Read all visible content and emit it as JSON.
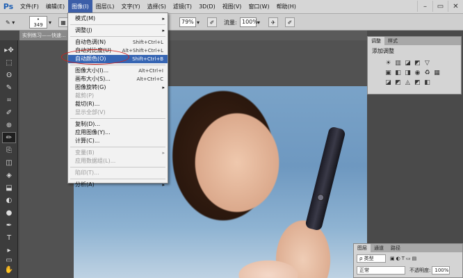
{
  "app": {
    "logo": "Ps"
  },
  "menubar": {
    "items": [
      {
        "label": "文件(F)"
      },
      {
        "label": "编辑(E)"
      },
      {
        "label": "图像(I)"
      },
      {
        "label": "图层(L)"
      },
      {
        "label": "文字(Y)"
      },
      {
        "label": "选择(S)"
      },
      {
        "label": "滤镜(T)"
      },
      {
        "label": "3D(D)"
      },
      {
        "label": "视图(V)"
      },
      {
        "label": "窗口(W)"
      },
      {
        "label": "帮助(H)"
      }
    ],
    "win": [
      "–",
      "▭",
      "✕"
    ]
  },
  "options": {
    "brush_size": "349",
    "opacity_value": "79%",
    "flow_label": "流量:",
    "flow_value": "100%"
  },
  "document": {
    "tab_title": "实例练习——快速..."
  },
  "image_menu": {
    "items": [
      {
        "label": "模式(M)",
        "shortcut": "",
        "arrow": "▸",
        "disabled": false
      },
      {
        "sep": true
      },
      {
        "label": "调整(J)",
        "shortcut": "",
        "arrow": "▸",
        "disabled": false
      },
      {
        "sep": true
      },
      {
        "label": "自动色调(N)",
        "shortcut": "Shift+Ctrl+L",
        "disabled": false
      },
      {
        "label": "自动对比度(U)",
        "shortcut": "Alt+Shift+Ctrl+L",
        "disabled": false
      },
      {
        "label": "自动颜色(O)",
        "shortcut": "Shift+Ctrl+B",
        "disabled": false,
        "highlighted": true
      },
      {
        "sep": true
      },
      {
        "label": "图像大小(I)...",
        "shortcut": "Alt+Ctrl+I",
        "disabled": false
      },
      {
        "label": "画布大小(S)...",
        "shortcut": "Alt+Ctrl+C",
        "disabled": false
      },
      {
        "label": "图像旋转(G)",
        "shortcut": "",
        "arrow": "▸",
        "disabled": false
      },
      {
        "label": "裁剪(P)",
        "shortcut": "",
        "disabled": true
      },
      {
        "label": "裁切(R)...",
        "shortcut": "",
        "disabled": false
      },
      {
        "label": "显示全部(V)",
        "shortcut": "",
        "disabled": true
      },
      {
        "sep": true
      },
      {
        "label": "复制(D)...",
        "shortcut": "",
        "disabled": false
      },
      {
        "label": "应用图像(Y)...",
        "shortcut": "",
        "disabled": false
      },
      {
        "label": "计算(C)...",
        "shortcut": "",
        "disabled": false
      },
      {
        "sep": true
      },
      {
        "label": "变量(B)",
        "shortcut": "",
        "arrow": "▸",
        "disabled": true
      },
      {
        "label": "应用数据组(L)...",
        "shortcut": "",
        "disabled": true
      },
      {
        "sep": true
      },
      {
        "label": "陷印(T)...",
        "shortcut": "",
        "disabled": true
      },
      {
        "sep": true
      },
      {
        "label": "分析(A)",
        "shortcut": "",
        "arrow": "▸",
        "disabled": false
      }
    ]
  },
  "adjustments_panel": {
    "tabs": [
      "调整",
      "样式"
    ],
    "title": "添加调整",
    "row1": [
      "☀",
      "▥",
      "◪",
      "◩",
      "▽"
    ],
    "row2": [
      "▣",
      "◧",
      "◨",
      "◉",
      "♻",
      "▦"
    ],
    "row3": [
      "◪",
      "◩",
      "◬",
      "◩",
      "◧"
    ]
  },
  "layers_panel": {
    "tabs": [
      "图层",
      "通道",
      "路径"
    ],
    "kind_label": "ρ 类型",
    "blend_mode": "正常",
    "opacity_label": "不透明度:",
    "opacity_value": "100%"
  },
  "toolbar": {
    "tools": [
      "▸✥",
      "⬚",
      "ʘ",
      "✎",
      "⌗",
      "✐",
      "⊕",
      "✏",
      "⎘",
      "◫",
      "◈",
      "⬓",
      "◐",
      "●",
      "✒",
      "T",
      "▸",
      "▭",
      "✋",
      "⌕"
    ]
  }
}
